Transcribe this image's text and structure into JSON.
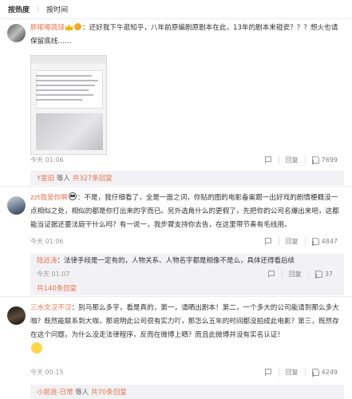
{
  "sort_tabs": [
    {
      "label": "按热度",
      "active": true
    },
    {
      "label": "按时间",
      "active": false
    }
  ],
  "comments": [
    {
      "user": "胖嘟嘟蔬球",
      "text": "：还好我下午逛知乎，八年前原编剧原剧本在此，13年的剧本来碰瓷？？？想火也请保留底线……",
      "time": "今天 01:06",
      "report_label": "",
      "reply_label": "回复",
      "likes": "7699",
      "sub_user": "Y星旧",
      "sub_text": "等人",
      "sub_count": "共327条回复"
    },
    {
      "user": "zzt我爱你啊",
      "text": "：不是，我仔细看了，全是一面之词，你贴的图的电影备案跟一出好戏的剧情梗概没一点相似之处，相似的都是你打出来的字而已。另外选角什么的更假了，先把你的公司名爆出来吧，这都能当证据还要法庭干什么吗？有一说一，我步骤支持你去告，在这里带节奏有毛线用。",
      "time": "今天 01:06",
      "reply_label": "回复",
      "likes": "4847",
      "sub_user": "陆远涛",
      "sub_text": "：法律手段是一定有的，人物关系、人物名字都是相像不是么，具体还得看后续",
      "sub_time": "今天 01:07",
      "sub_reply_label": "回复",
      "sub_likes": "37",
      "sub_more": "共140条回复"
    },
    {
      "user": "三水文汉不汉",
      "text": "：别马那么多字，看是真的，第一，请晒出剧本！第二，一个多大的公司能请到那么多大咖？既然能联系到大咖，那说明此公司很有实力吖，那怎么五年的时间都没拍成此电影？第三，既然存在这个问题，为什么没走法律程序，反而在微博上晒？而且此微博并没有实名认证！",
      "time": "今天 00:15",
      "reply_label": "回复",
      "likes": "4249",
      "sub_user": "小屁孩-日常",
      "sub_text": "等人",
      "sub_count": "共70条回复"
    }
  ],
  "colors": {
    "username": "#eb7350",
    "meta": "#999999",
    "subbox": "#f2f2f5"
  }
}
